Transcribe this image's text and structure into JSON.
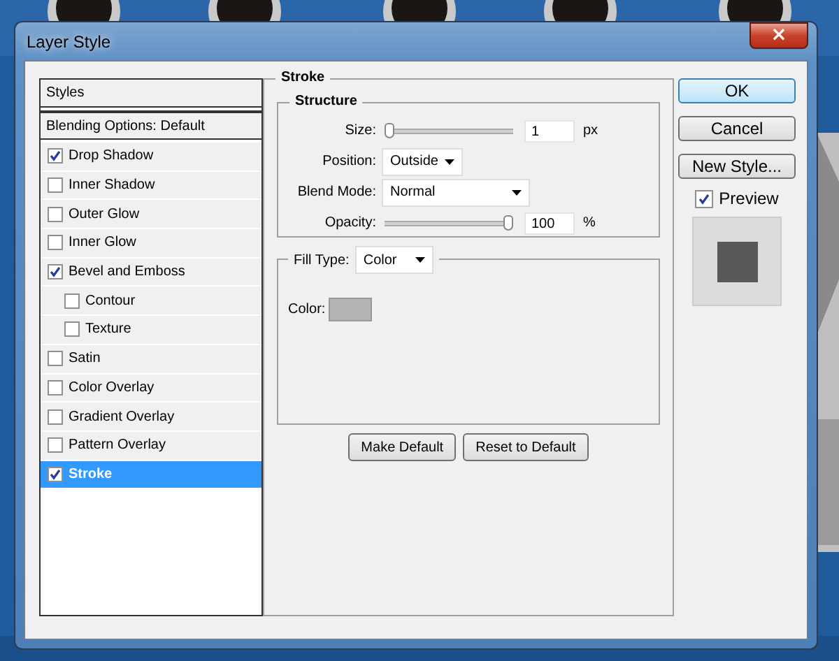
{
  "window": {
    "title": "Layer Style",
    "close": "×"
  },
  "styles_list": {
    "header": "Styles",
    "blending": "Blending Options: Default",
    "items": [
      {
        "label": "Drop Shadow",
        "checked": true,
        "selected": false,
        "nested": false
      },
      {
        "label": "Inner Shadow",
        "checked": false,
        "selected": false,
        "nested": false
      },
      {
        "label": "Outer Glow",
        "checked": false,
        "selected": false,
        "nested": false
      },
      {
        "label": "Inner Glow",
        "checked": false,
        "selected": false,
        "nested": false
      },
      {
        "label": "Bevel and Emboss",
        "checked": true,
        "selected": false,
        "nested": false
      },
      {
        "label": "Contour",
        "checked": false,
        "selected": false,
        "nested": true
      },
      {
        "label": "Texture",
        "checked": false,
        "selected": false,
        "nested": true
      },
      {
        "label": "Satin",
        "checked": false,
        "selected": false,
        "nested": false
      },
      {
        "label": "Color Overlay",
        "checked": false,
        "selected": false,
        "nested": false
      },
      {
        "label": "Gradient Overlay",
        "checked": false,
        "selected": false,
        "nested": false
      },
      {
        "label": "Pattern Overlay",
        "checked": false,
        "selected": false,
        "nested": false
      },
      {
        "label": "Stroke",
        "checked": true,
        "selected": true,
        "nested": false
      }
    ]
  },
  "stroke": {
    "title": "Stroke",
    "structure": {
      "title": "Structure",
      "size": {
        "label": "Size:",
        "value": "1",
        "unit": "px",
        "level": 0.0
      },
      "position": {
        "label": "Position:",
        "value": "Outside"
      },
      "blend_mode": {
        "label": "Blend Mode:",
        "value": "Normal"
      },
      "opacity": {
        "label": "Opacity:",
        "value": "100",
        "unit": "%",
        "level": 1.0
      }
    },
    "fill": {
      "label": "Fill Type:",
      "value": "Color",
      "color_label": "Color:",
      "color": "#b4b4b4"
    },
    "buttons": [
      "Make Default",
      "Reset to Default"
    ]
  },
  "actions": {
    "ok": "OK",
    "cancel": "Cancel",
    "new_style": "New Style...",
    "preview": {
      "label": "Preview",
      "checked": true
    }
  }
}
